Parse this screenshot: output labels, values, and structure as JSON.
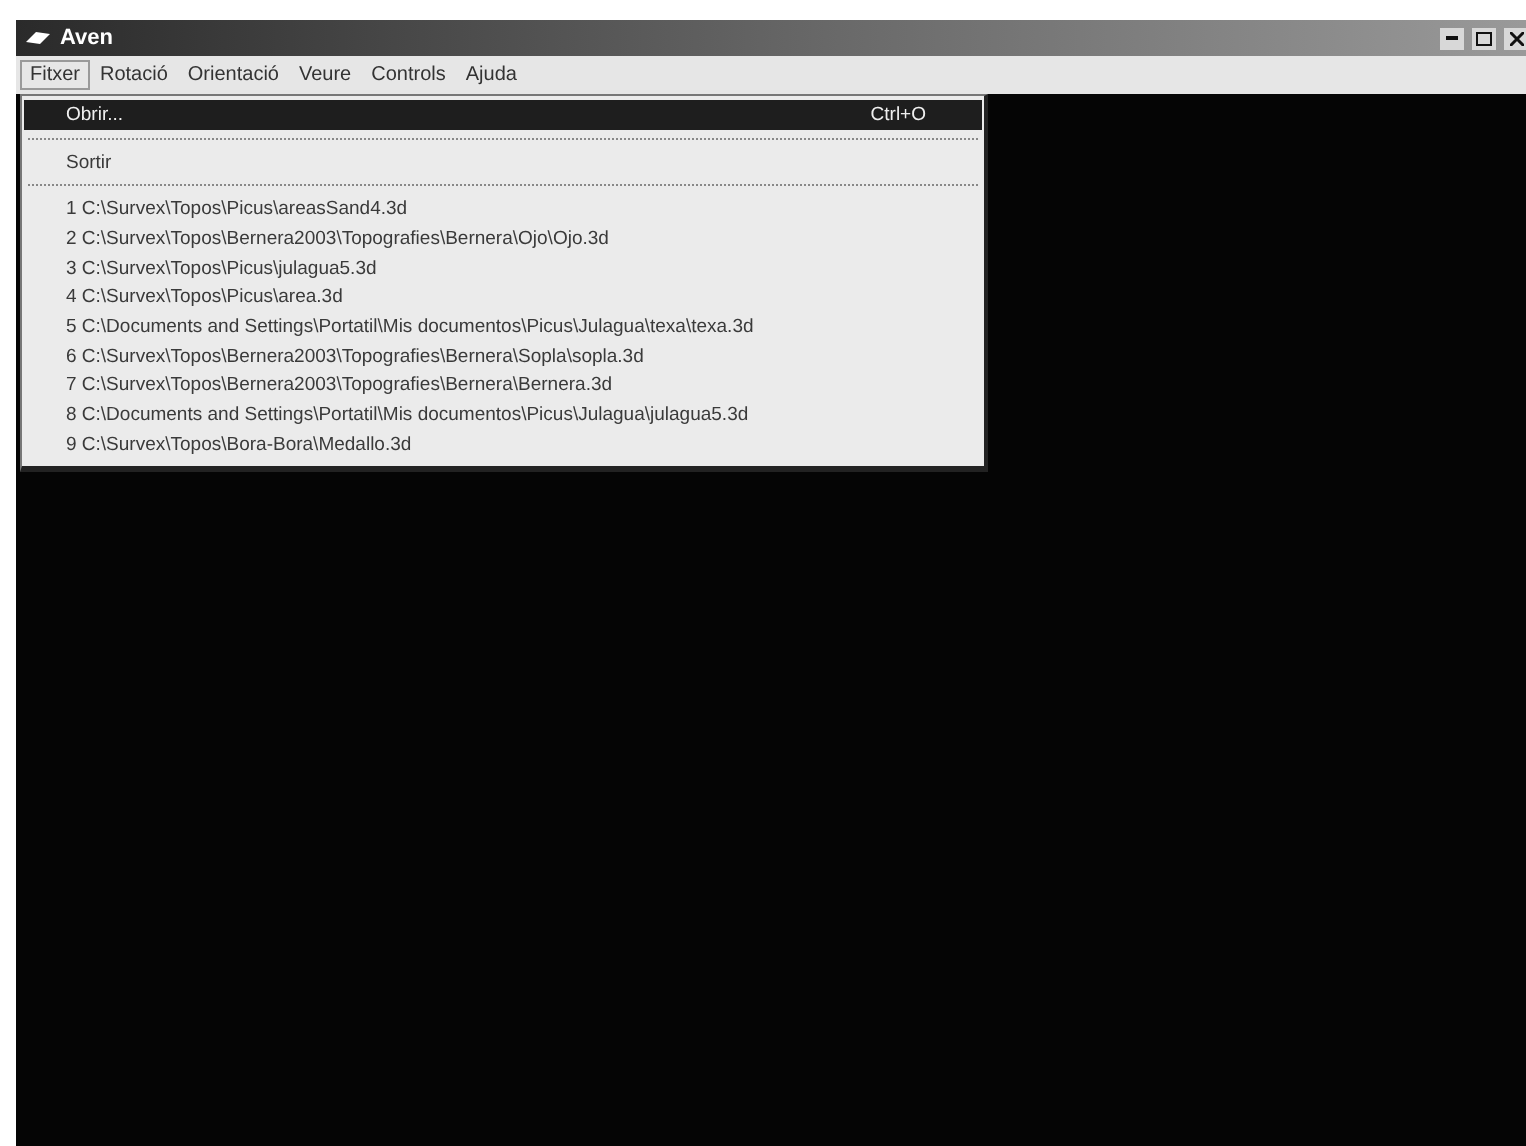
{
  "window": {
    "title": "Aven"
  },
  "menubar": [
    {
      "label": "Fitxer",
      "selected": true
    },
    {
      "label": "Rotació",
      "selected": false
    },
    {
      "label": "Orientació",
      "selected": false
    },
    {
      "label": "Veure",
      "selected": false
    },
    {
      "label": "Controls",
      "selected": false
    },
    {
      "label": "Ajuda",
      "selected": false
    }
  ],
  "menu": [
    {
      "kind": "item",
      "label": "Obrir...",
      "shortcut": "Ctrl+O",
      "selected": true
    },
    {
      "kind": "separator"
    },
    {
      "kind": "item",
      "label": "Sortir",
      "selected": false
    },
    {
      "kind": "separator"
    },
    {
      "kind": "item",
      "label": "1 C:\\Survex\\Topos\\Picus\\areasSand4.3d",
      "selected": false
    },
    {
      "kind": "item",
      "label": "2 C:\\Survex\\Topos\\Bernera2003\\Topografies\\Bernera\\Ojo\\Ojo.3d",
      "selected": false
    },
    {
      "kind": "item",
      "label": "3 C:\\Survex\\Topos\\Picus\\julagua5.3d",
      "selected": false
    },
    {
      "kind": "item",
      "label": "4 C:\\Survex\\Topos\\Picus\\area.3d",
      "selected": false
    },
    {
      "kind": "item",
      "label": "5 C:\\Documents and Settings\\Portatil\\Mis documentos\\Picus\\Julagua\\texa\\texa.3d",
      "selected": false
    },
    {
      "kind": "item",
      "label": "6 C:\\Survex\\Topos\\Bernera2003\\Topografies\\Bernera\\Sopla\\sopla.3d",
      "selected": false
    },
    {
      "kind": "item",
      "label": "7 C:\\Survex\\Topos\\Bernera2003\\Topografies\\Bernera\\Bernera.3d",
      "selected": false
    },
    {
      "kind": "item",
      "label": "8 C:\\Documents and Settings\\Portatil\\Mis documentos\\Picus\\Julagua\\julagua5.3d",
      "selected": false
    },
    {
      "kind": "item",
      "label": "9 C:\\Survex\\Topos\\Bora-Bora\\Medallo.3d",
      "selected": false
    }
  ]
}
